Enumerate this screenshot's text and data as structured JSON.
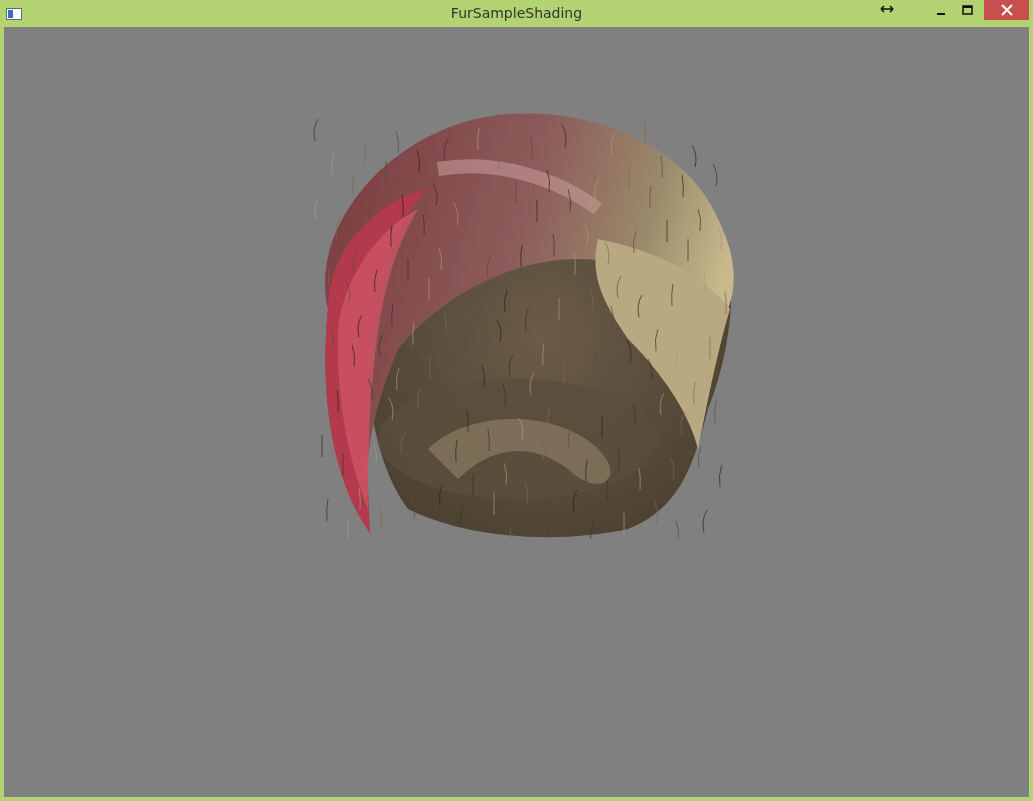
{
  "window": {
    "title": "FurSampleShading"
  }
}
